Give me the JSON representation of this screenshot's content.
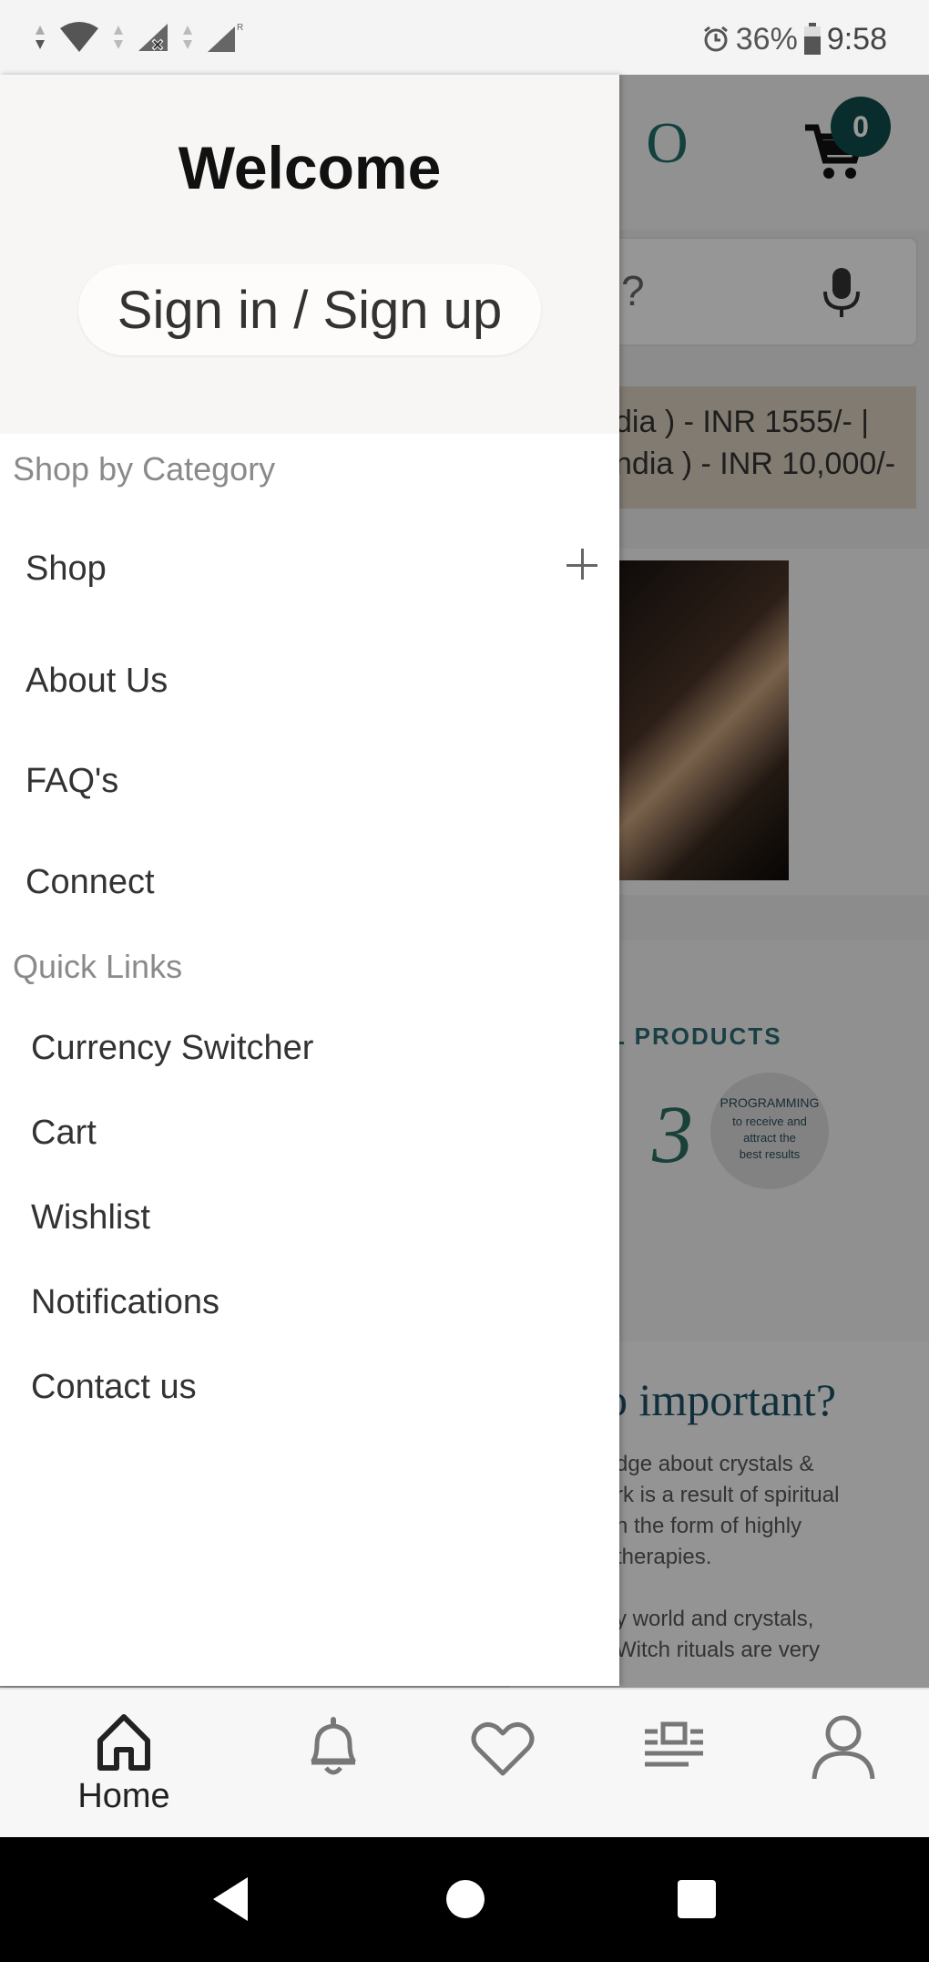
{
  "status_bar": {
    "battery_percent": "36%",
    "time": "9:58"
  },
  "background": {
    "logo_fragment": "IO",
    "cart_count": "0",
    "search_fragment": "?",
    "banner_lines": [
      "dia ) - INR 1555/- |",
      "ndia ) - INR 10,000/-"
    ],
    "products_heading_fragment": "L PRODUCTS",
    "badge_lines": [
      "PROGRAMMING",
      "to receive and",
      "attract the",
      "best results"
    ],
    "badge_number": "3",
    "important_heading_fragment": "o important?",
    "paragraph_lines": [
      "dge about crystals &",
      "rk is a result of spiritual",
      "n the form of highly",
      "therapies.",
      "",
      "y world and crystals,",
      "Witch rituals are very"
    ]
  },
  "drawer": {
    "welcome": "Welcome",
    "signin_label": "Sign in / Sign up",
    "category_title": "Shop by Category",
    "menu": [
      {
        "label": "Shop",
        "expandable": true
      },
      {
        "label": "About Us"
      },
      {
        "label": "FAQ's"
      },
      {
        "label": "Connect"
      }
    ],
    "quick_title": "Quick Links",
    "quick_links": [
      "Currency Switcher",
      "Cart",
      "Wishlist",
      "Notifications",
      "Contact us"
    ]
  },
  "bottom_nav": {
    "items": [
      {
        "label": "Home",
        "icon": "home-icon",
        "active": true
      },
      {
        "label": "",
        "icon": "bell-icon"
      },
      {
        "label": "",
        "icon": "heart-icon"
      },
      {
        "label": "",
        "icon": "feed-icon"
      },
      {
        "label": "",
        "icon": "user-icon"
      }
    ]
  },
  "colors": {
    "accent": "#0f4c4a",
    "drawer_header_bg": "#f7f6f4",
    "section_title": "#8a8a8a"
  }
}
